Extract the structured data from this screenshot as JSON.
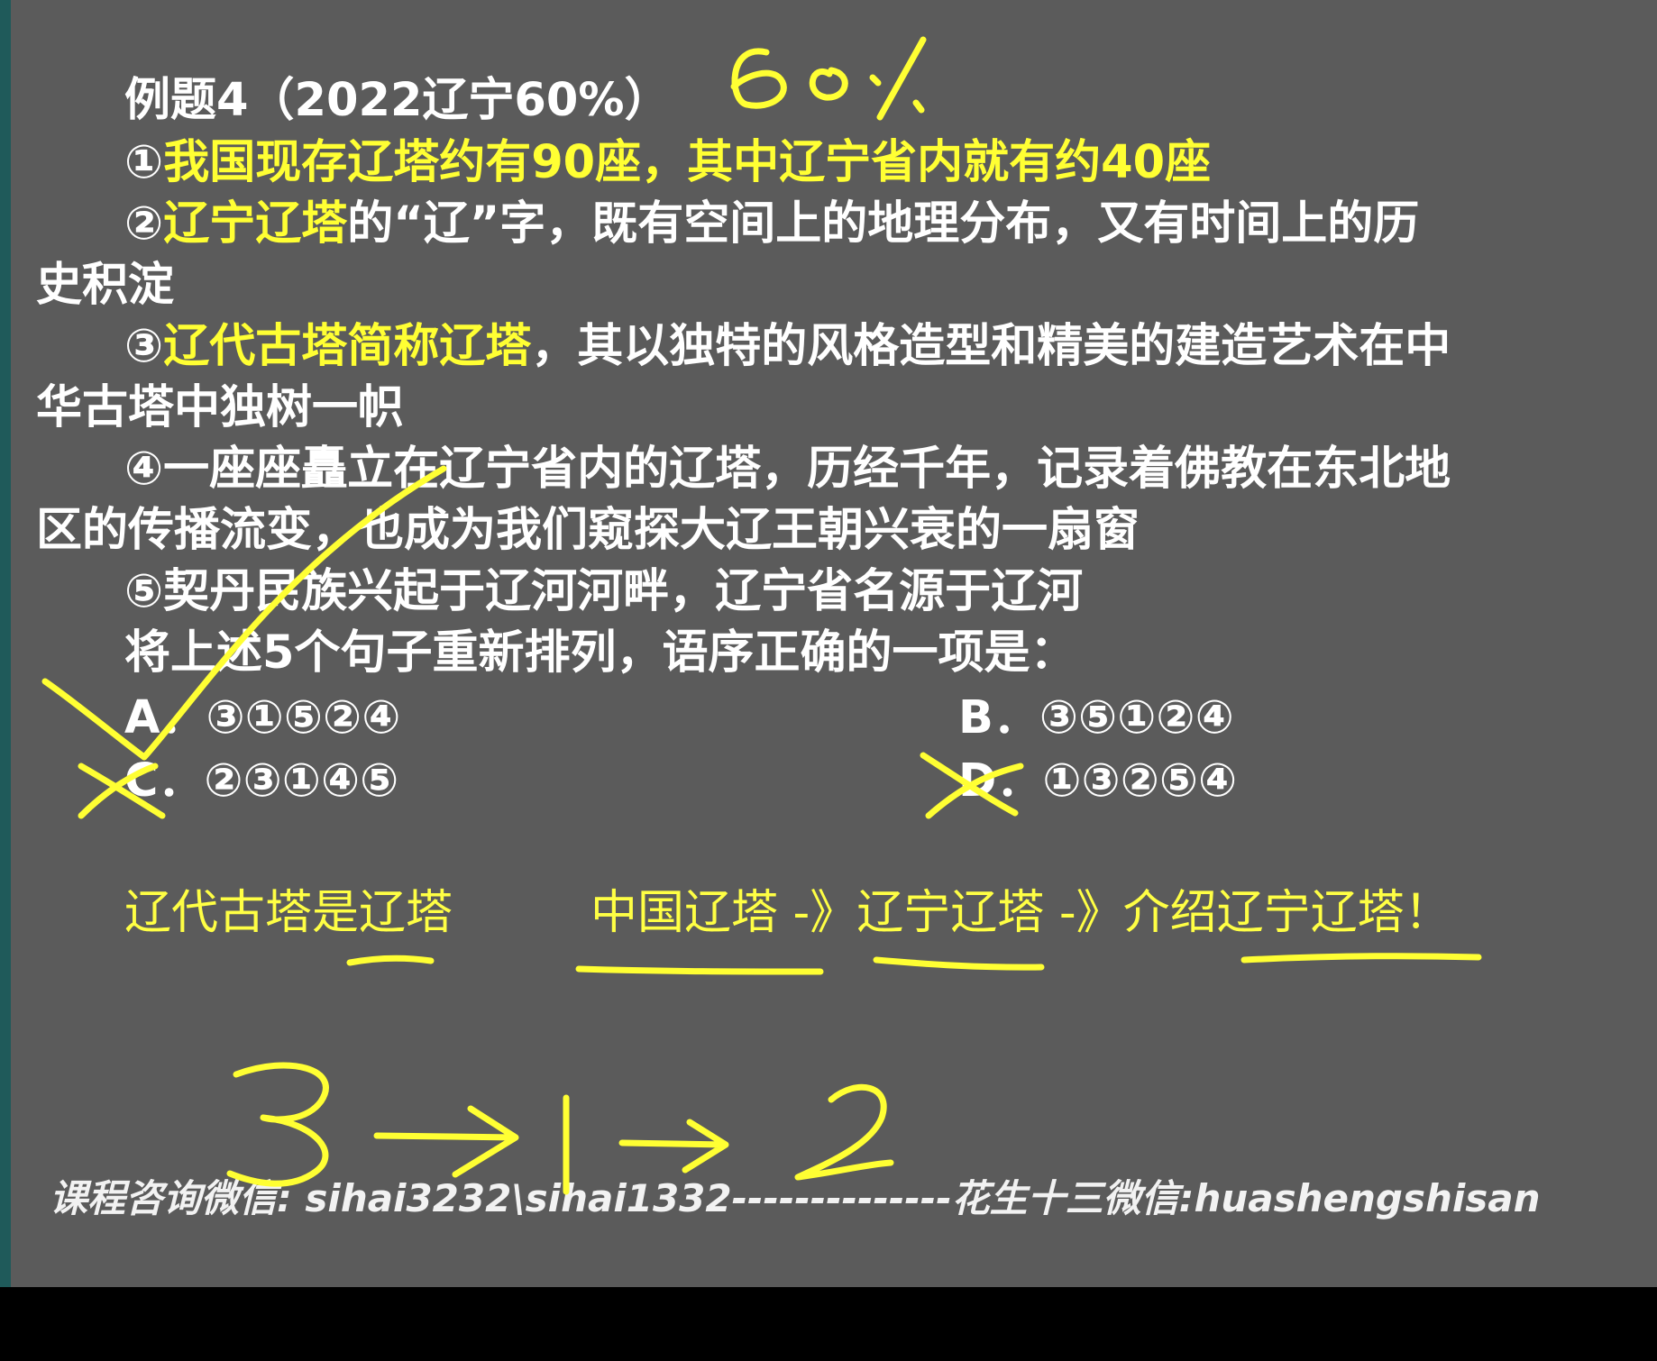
{
  "question": {
    "title": "例题4（2022辽宁60%）",
    "s1_num": "①",
    "s1_hl": "我国现存辽塔约有90座，其中辽宁省内就有约40座",
    "s2_num": "②",
    "s2_hl": "辽宁辽塔",
    "s2_rest": "的“辽”字，既有空间上的地理分布，又有时间上的历",
    "s2_cont": "史积淀",
    "s3_num": "③",
    "s3_hl": "辽代古塔简称辽塔",
    "s3_rest": "，其以独特的风格造型和精美的建造艺术在中",
    "s3_cont": "华古塔中独树一帜",
    "s4": "④一座座矗立在辽宁省内的辽塔，历经千年，记录着佛教在东北地",
    "s4_cont": "区的传播流变，也成为我们窥探大辽王朝兴衰的一扇窗",
    "s5": "⑤契丹民族兴起于辽河河畔，辽宁省名源于辽河",
    "prompt": "将上述5个句子重新排列，语序正确的一项是：",
    "options": {
      "a": "A．③①⑤②④",
      "b": "B．③⑤①②④",
      "c": "C．②③①④⑤",
      "d": "D．①③②⑤④"
    }
  },
  "notes": {
    "n1": "辽代古塔是辽塔",
    "n2": "中国辽塔 -》辽宁辽塔   -》介绍辽宁辽塔！"
  },
  "handwriting": {
    "rate": "60%",
    "sequence": "3→1→2"
  },
  "footer": {
    "contact": "课程咨询微信: sihai3232\\sihai1332--------------花生十三微信:huashengshisan"
  },
  "colors": {
    "background": "#5b5b5b",
    "highlight": "#ffff33",
    "ink": "#ffff33"
  }
}
